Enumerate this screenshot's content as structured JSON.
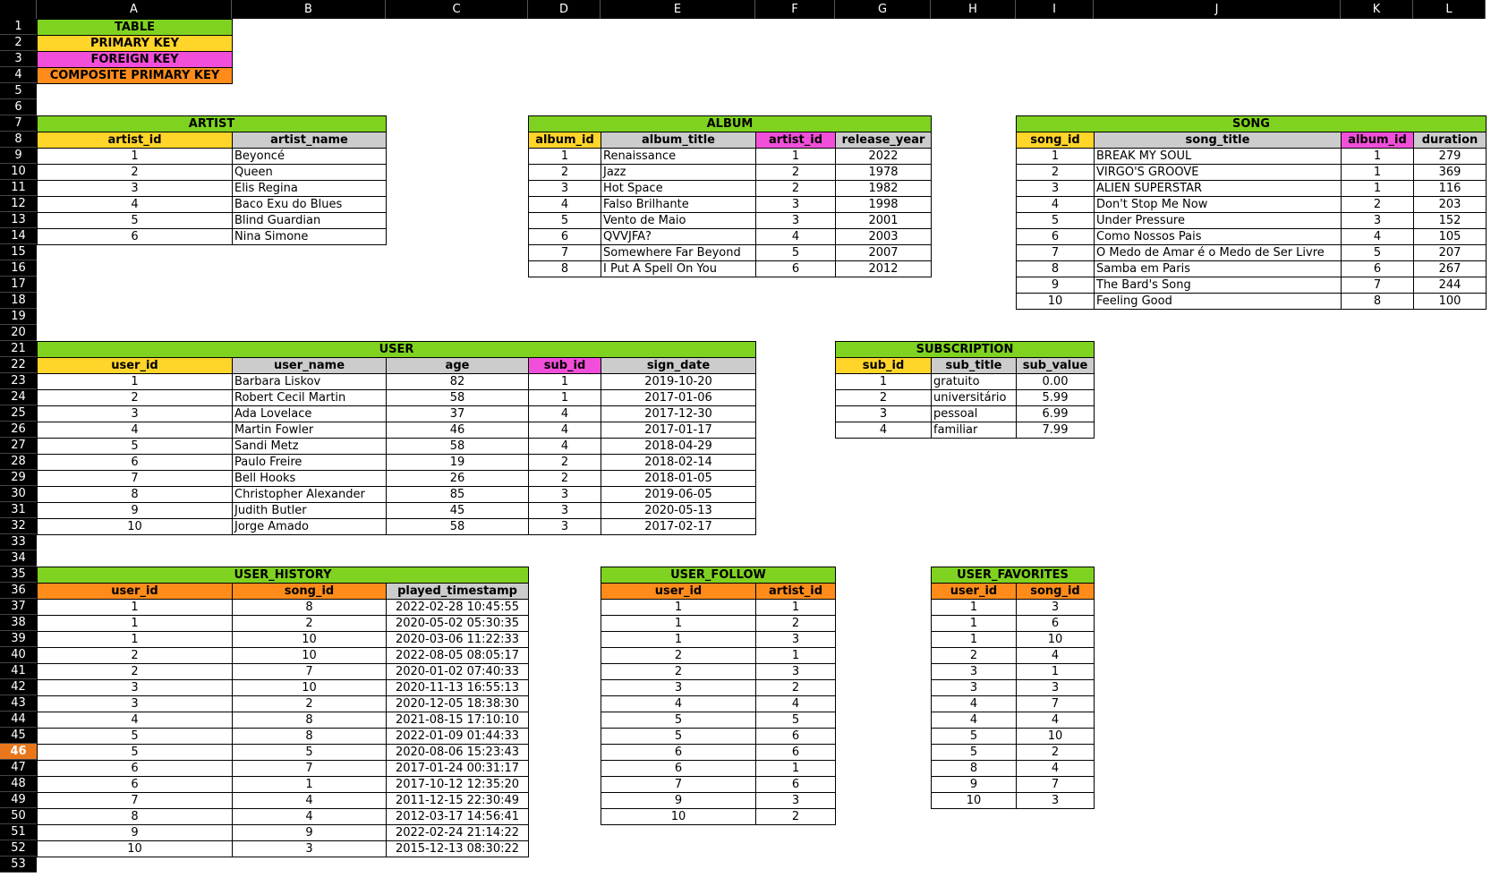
{
  "colors": {
    "table": "#7fd320",
    "primary_key": "#ffd52a",
    "foreign_key": "#f14fd9",
    "composite_key": "#ff8c1a",
    "plain_header": "#cccccc",
    "active_row": "#e8771c"
  },
  "columns": [
    "A",
    "B",
    "C",
    "D",
    "E",
    "F",
    "G",
    "H",
    "I",
    "J",
    "K",
    "L"
  ],
  "active_row": 46,
  "legend": [
    {
      "label": "TABLE",
      "color": "table"
    },
    {
      "label": "PRIMARY KEY",
      "color": "primary_key"
    },
    {
      "label": "FOREIGN KEY",
      "color": "foreign_key"
    },
    {
      "label": "COMPOSITE PRIMARY KEY",
      "color": "composite_key"
    }
  ],
  "tables": [
    {
      "id": "artist",
      "title": "ARTIST",
      "row": 7,
      "cols": [
        0,
        1
      ],
      "headers": [
        {
          "label": "artist_id",
          "key": "primary_key"
        },
        {
          "label": "artist_name",
          "key": "plain_header"
        }
      ],
      "align": [
        "c",
        "l"
      ],
      "rows": [
        [
          "1",
          "Beyoncé"
        ],
        [
          "2",
          "Queen"
        ],
        [
          "3",
          "Elis Regina"
        ],
        [
          "4",
          "Baco Exu do Blues"
        ],
        [
          "5",
          "Blind Guardian"
        ],
        [
          "6",
          "Nina Simone"
        ]
      ]
    },
    {
      "id": "album",
      "title": "ALBUM",
      "row": 7,
      "cols": [
        3,
        4,
        5,
        6
      ],
      "headers": [
        {
          "label": "album_id",
          "key": "primary_key"
        },
        {
          "label": "album_title",
          "key": "plain_header"
        },
        {
          "label": "artist_id",
          "key": "foreign_key"
        },
        {
          "label": "release_year",
          "key": "plain_header"
        }
      ],
      "align": [
        "c",
        "l",
        "c",
        "c"
      ],
      "rows": [
        [
          "1",
          "Renaissance",
          "1",
          "2022"
        ],
        [
          "2",
          "Jazz",
          "2",
          "1978"
        ],
        [
          "3",
          "Hot Space",
          "2",
          "1982"
        ],
        [
          "4",
          "Falso Brilhante",
          "3",
          "1998"
        ],
        [
          "5",
          "Vento de Maio",
          "3",
          "2001"
        ],
        [
          "6",
          "QVVJFA?",
          "4",
          "2003"
        ],
        [
          "7",
          "Somewhere Far Beyond",
          "5",
          "2007"
        ],
        [
          "8",
          "I Put A Spell On You",
          "6",
          "2012"
        ]
      ]
    },
    {
      "id": "song",
      "title": "SONG",
      "row": 7,
      "cols": [
        8,
        9,
        10,
        11
      ],
      "headers": [
        {
          "label": "song_id",
          "key": "primary_key"
        },
        {
          "label": "song_title",
          "key": "plain_header"
        },
        {
          "label": "album_id",
          "key": "foreign_key"
        },
        {
          "label": "duration",
          "key": "plain_header"
        }
      ],
      "align": [
        "c",
        "l",
        "c",
        "c"
      ],
      "rows": [
        [
          "1",
          "BREAK MY SOUL",
          "1",
          "279"
        ],
        [
          "2",
          "VIRGO'S GROOVE",
          "1",
          "369"
        ],
        [
          "3",
          "ALIEN SUPERSTAR",
          "1",
          "116"
        ],
        [
          "4",
          "Don't Stop Me Now",
          "2",
          "203"
        ],
        [
          "5",
          "Under Pressure",
          "3",
          "152"
        ],
        [
          "6",
          "Como Nossos Pais",
          "4",
          "105"
        ],
        [
          "7",
          "O Medo de Amar é o Medo de Ser Livre",
          "5",
          "207"
        ],
        [
          "8",
          "Samba em Paris",
          "6",
          "267"
        ],
        [
          "9",
          "The Bard's Song",
          "7",
          "244"
        ],
        [
          "10",
          "Feeling Good",
          "8",
          "100"
        ]
      ]
    },
    {
      "id": "user",
      "title": "USER",
      "row": 21,
      "cols": [
        0,
        1,
        2,
        3,
        4
      ],
      "headers": [
        {
          "label": "user_id",
          "key": "primary_key"
        },
        {
          "label": "user_name",
          "key": "plain_header"
        },
        {
          "label": "age",
          "key": "plain_header"
        },
        {
          "label": "sub_id",
          "key": "foreign_key"
        },
        {
          "label": "sign_date",
          "key": "plain_header"
        }
      ],
      "align": [
        "c",
        "l",
        "c",
        "c",
        "c"
      ],
      "rows": [
        [
          "1",
          "Barbara Liskov",
          "82",
          "1",
          "2019-10-20"
        ],
        [
          "2",
          "Robert Cecil Martin",
          "58",
          "1",
          "2017-01-06"
        ],
        [
          "3",
          "Ada Lovelace",
          "37",
          "4",
          "2017-12-30"
        ],
        [
          "4",
          "Martin Fowler",
          "46",
          "4",
          "2017-01-17"
        ],
        [
          "5",
          "Sandi Metz",
          "58",
          "4",
          "2018-04-29"
        ],
        [
          "6",
          "Paulo Freire",
          "19",
          "2",
          "2018-02-14"
        ],
        [
          "7",
          "Bell Hooks",
          "26",
          "2",
          "2018-01-05"
        ],
        [
          "8",
          "Christopher Alexander",
          "85",
          "3",
          "2019-06-05"
        ],
        [
          "9",
          "Judith Butler",
          "45",
          "3",
          "2020-05-13"
        ],
        [
          "10",
          "Jorge Amado",
          "58",
          "3",
          "2017-02-17"
        ]
      ]
    },
    {
      "id": "subscription",
      "title": "SUBSCRIPTION",
      "row": 21,
      "cols": [
        6,
        7,
        8
      ],
      "headers": [
        {
          "label": "sub_id",
          "key": "primary_key"
        },
        {
          "label": "sub_title",
          "key": "plain_header"
        },
        {
          "label": "sub_value",
          "key": "plain_header"
        }
      ],
      "align": [
        "c",
        "l",
        "c"
      ],
      "rows": [
        [
          "1",
          "gratuito",
          "0.00"
        ],
        [
          "2",
          "universitário",
          "5.99"
        ],
        [
          "3",
          "pessoal",
          "6.99"
        ],
        [
          "4",
          "familiar",
          "7.99"
        ]
      ]
    },
    {
      "id": "user_history",
      "title": "USER_HISTORY",
      "row": 35,
      "cols": [
        0,
        1,
        2
      ],
      "headers": [
        {
          "label": "user_id",
          "key": "composite_key"
        },
        {
          "label": "song_id",
          "key": "composite_key"
        },
        {
          "label": "played_timestamp",
          "key": "plain_header"
        }
      ],
      "align": [
        "c",
        "c",
        "c"
      ],
      "rows": [
        [
          "1",
          "8",
          "2022-02-28 10:45:55"
        ],
        [
          "1",
          "2",
          "2020-05-02 05:30:35"
        ],
        [
          "1",
          "10",
          "2020-03-06 11:22:33"
        ],
        [
          "2",
          "10",
          "2022-08-05 08:05:17"
        ],
        [
          "2",
          "7",
          "2020-01-02 07:40:33"
        ],
        [
          "3",
          "10",
          "2020-11-13 16:55:13"
        ],
        [
          "3",
          "2",
          "2020-12-05 18:38:30"
        ],
        [
          "4",
          "8",
          "2021-08-15 17:10:10"
        ],
        [
          "5",
          "8",
          "2022-01-09 01:44:33"
        ],
        [
          "5",
          "5",
          "2020-08-06 15:23:43"
        ],
        [
          "6",
          "7",
          "2017-01-24 00:31:17"
        ],
        [
          "6",
          "1",
          "2017-10-12 12:35:20"
        ],
        [
          "7",
          "4",
          "2011-12-15 22:30:49"
        ],
        [
          "8",
          "4",
          "2012-03-17 14:56:41"
        ],
        [
          "9",
          "9",
          "2022-02-24 21:14:22"
        ],
        [
          "10",
          "3",
          "2015-12-13 08:30:22"
        ]
      ]
    },
    {
      "id": "user_follow",
      "title": "USER_FOLLOW",
      "row": 35,
      "cols": [
        4,
        5
      ],
      "headers": [
        {
          "label": "user_id",
          "key": "composite_key"
        },
        {
          "label": "artist_id",
          "key": "composite_key"
        }
      ],
      "align": [
        "c",
        "c"
      ],
      "rows": [
        [
          "1",
          "1"
        ],
        [
          "1",
          "2"
        ],
        [
          "1",
          "3"
        ],
        [
          "2",
          "1"
        ],
        [
          "2",
          "3"
        ],
        [
          "3",
          "2"
        ],
        [
          "4",
          "4"
        ],
        [
          "5",
          "5"
        ],
        [
          "5",
          "6"
        ],
        [
          "6",
          "6"
        ],
        [
          "6",
          "1"
        ],
        [
          "7",
          "6"
        ],
        [
          "9",
          "3"
        ],
        [
          "10",
          "2"
        ]
      ]
    },
    {
      "id": "user_favorites",
      "title": "USER_FAVORITES",
      "row": 35,
      "cols": [
        7,
        8
      ],
      "headers": [
        {
          "label": "user_id",
          "key": "composite_key"
        },
        {
          "label": "song_id",
          "key": "composite_key"
        }
      ],
      "align": [
        "c",
        "c"
      ],
      "rows": [
        [
          "1",
          "3"
        ],
        [
          "1",
          "6"
        ],
        [
          "1",
          "10"
        ],
        [
          "2",
          "4"
        ],
        [
          "3",
          "1"
        ],
        [
          "3",
          "3"
        ],
        [
          "4",
          "7"
        ],
        [
          "4",
          "4"
        ],
        [
          "5",
          "10"
        ],
        [
          "5",
          "2"
        ],
        [
          "8",
          "4"
        ],
        [
          "9",
          "7"
        ],
        [
          "10",
          "3"
        ]
      ]
    }
  ]
}
